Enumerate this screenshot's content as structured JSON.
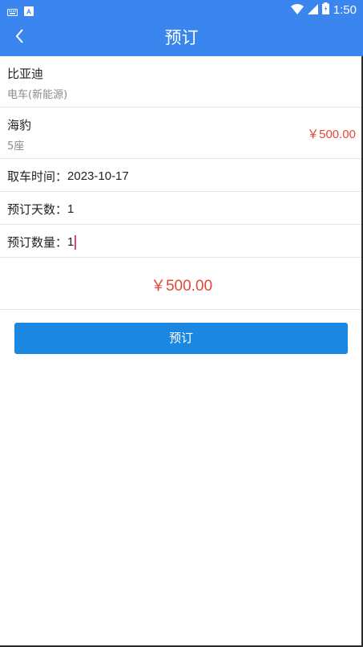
{
  "status_bar": {
    "time": "1:50",
    "icons": [
      "keyboard-icon",
      "notification-a-icon",
      "wifi-icon",
      "cell-signal-icon",
      "battery-icon"
    ]
  },
  "app_bar": {
    "title": "预订",
    "back_icon": "chevron-left-icon"
  },
  "car": {
    "brand": "比亚迪",
    "category": "电车(新能源)"
  },
  "model": {
    "name": "海豹",
    "seats": "5座",
    "price": "￥500.00"
  },
  "fields": {
    "pickup_time": {
      "label": "取车时间：",
      "value": "2023-10-17"
    },
    "days": {
      "label": "预订天数：",
      "value": "1"
    },
    "quantity": {
      "label": "预订数量：",
      "value": "1"
    }
  },
  "total": "￥500.00",
  "book_button": "预订",
  "colors": {
    "primary_bar": "#3a86ee",
    "button": "#1a88e0",
    "price": "#e2473a"
  }
}
